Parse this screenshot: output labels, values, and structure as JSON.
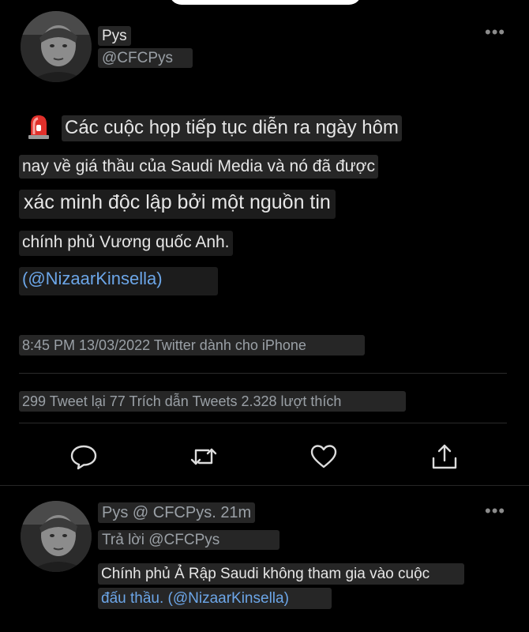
{
  "main_tweet": {
    "author_name": "Pys",
    "author_handle": "@CFCPys",
    "body_lines": [
      "Các cuộc họp tiếp tục diễn ra ngày hôm",
      "nay về giá thầu của Saudi Media và nó đã được",
      "xác minh độc lập bởi một nguồn tin",
      "chính phủ Vương quốc Anh."
    ],
    "source_mention": "(@NizaarKinsella)",
    "timestamp_line": "8:45 PM 13/03/2022 Twitter dành cho iPhone",
    "stats_line": "299 Tweet lại 77 Trích dẫn Tweets 2.328 lượt thích",
    "more_label": "•••"
  },
  "actions": {
    "reply_icon": "reply-bubble-icon",
    "retweet_icon": "retweet-arrows-icon",
    "like_icon": "heart-icon",
    "share_icon": "share-upload-icon"
  },
  "reply_tweet": {
    "header_line": "Pys @ CFCPys. 21m",
    "replying_to": "Trả lời @CFCPys",
    "body_line_1": "Chính phủ Ả Rập Saudi không tham gia vào cuộc",
    "body_line_2": "đấu thầu. (@NizaarKinsella)",
    "more_label": "•••"
  },
  "colors": {
    "background": "#000000",
    "link": "#6ca6e8",
    "chip": "#262626",
    "icon": "#dcdcdc",
    "siren": "#e0302b"
  }
}
